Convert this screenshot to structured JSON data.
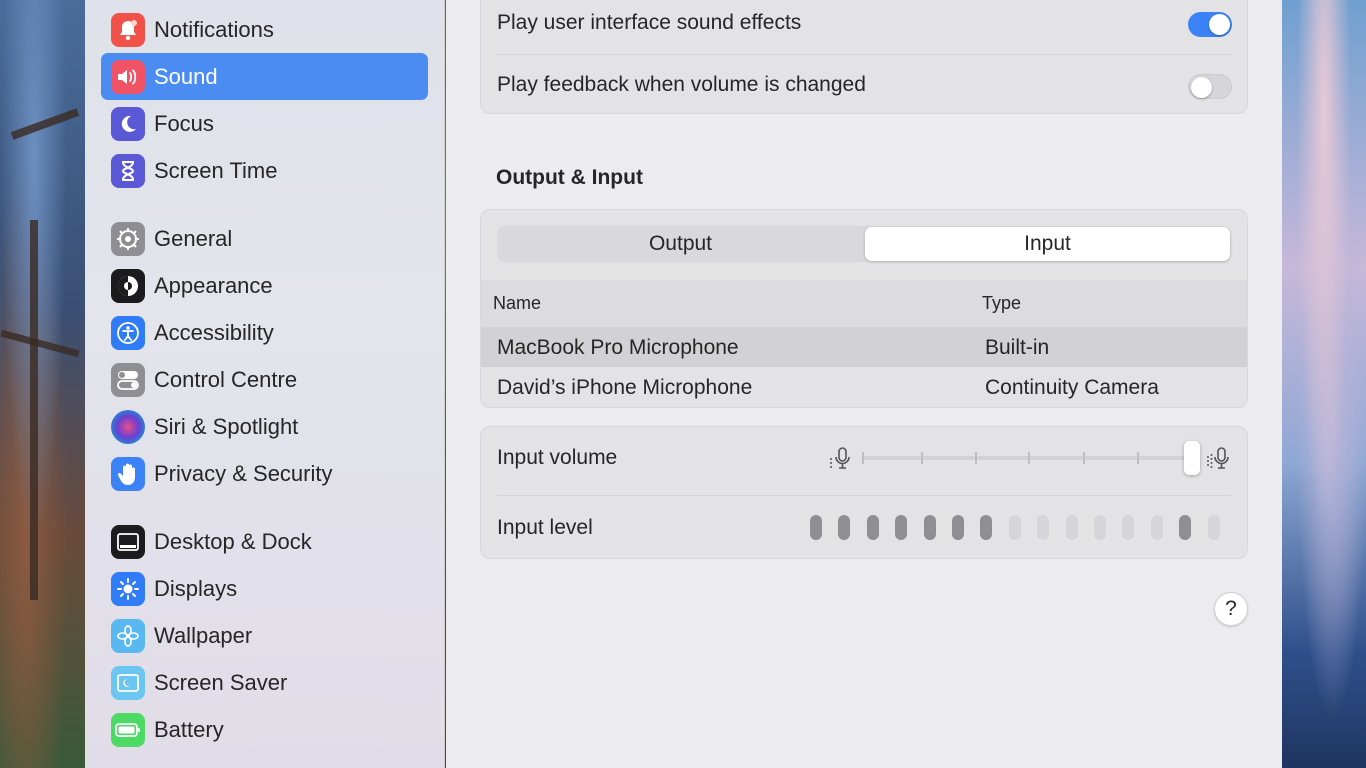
{
  "sidebar": {
    "items": [
      {
        "label": "Notifications",
        "icon": "bell-icon",
        "color": "#f0524a"
      },
      {
        "label": "Sound",
        "icon": "speaker-icon",
        "color": "#f05266"
      },
      {
        "label": "Focus",
        "icon": "moon-icon",
        "color": "#5b58d6"
      },
      {
        "label": "Screen Time",
        "icon": "hourglass-icon",
        "color": "#5b58d6"
      },
      {
        "label": "General",
        "icon": "gear-icon",
        "color": "#8e8e93"
      },
      {
        "label": "Appearance",
        "icon": "appearance-icon",
        "color": "#1c1c1e"
      },
      {
        "label": "Accessibility",
        "icon": "accessibility-icon",
        "color": "#2f7cf6"
      },
      {
        "label": "Control Centre",
        "icon": "toggles-icon",
        "color": "#8e8e93"
      },
      {
        "label": "Siri & Spotlight",
        "icon": "siri-icon",
        "color": "#2a2a55"
      },
      {
        "label": "Privacy & Security",
        "icon": "hand-icon",
        "color": "#3b82f6"
      },
      {
        "label": "Desktop & Dock",
        "icon": "dock-icon",
        "color": "#1c1c1e"
      },
      {
        "label": "Displays",
        "icon": "sun-icon",
        "color": "#2f7cf6"
      },
      {
        "label": "Wallpaper",
        "icon": "flower-icon",
        "color": "#5ab8f0"
      },
      {
        "label": "Screen Saver",
        "icon": "screensaver-icon",
        "color": "#6cc7f0"
      },
      {
        "label": "Battery",
        "icon": "battery-icon",
        "color": "#4cd964"
      }
    ],
    "selected": "Sound"
  },
  "alerts": {
    "ui_sounds_label": "Play user interface sound effects",
    "ui_sounds_on": true,
    "feedback_label": "Play feedback when volume is changed",
    "feedback_on": false
  },
  "output_input": {
    "title": "Output & Input",
    "tabs": [
      "Output",
      "Input"
    ],
    "active_tab": "Input",
    "columns": [
      "Name",
      "Type"
    ],
    "rows": [
      {
        "name": "MacBook Pro Microphone",
        "type": "Built-in",
        "selected": true
      },
      {
        "name": "David’s iPhone Microphone",
        "type": "Continuity Camera",
        "selected": false
      }
    ]
  },
  "input_volume": {
    "label": "Input volume",
    "value": 1.0
  },
  "input_level": {
    "label": "Input level",
    "segments": 15,
    "lit": [
      true,
      true,
      true,
      true,
      true,
      true,
      true,
      false,
      false,
      false,
      false,
      false,
      false,
      true,
      false
    ]
  },
  "help": {
    "symbol": "?"
  },
  "colors": {
    "accent": "#3b82f6",
    "selected_sidebar": "#4a8cf2"
  }
}
